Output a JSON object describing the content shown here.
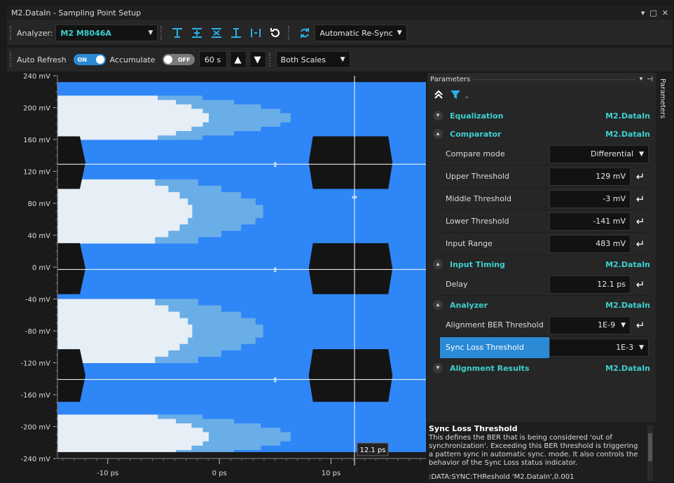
{
  "window": {
    "title": "M2.DataIn - Sampling Point Setup",
    "controls": [
      "▾",
      "□",
      "✕"
    ]
  },
  "toolbar1": {
    "analyzer_label": "Analyzer:",
    "analyzer_value": "M2 M8046A",
    "sync_mode": "Automatic Re-Sync"
  },
  "toolbar2": {
    "auto_refresh_label": "Auto Refresh",
    "auto_refresh_state": "ON",
    "accumulate_label": "Accumulate",
    "accumulate_state": "OFF",
    "interval": "60 s",
    "scales": "Both Scales"
  },
  "chart_data": {
    "type": "heatmap",
    "y_ticks": [
      "240 mV",
      "200 mV",
      "160 mV",
      "120 mV",
      "80 mV",
      "40 mV",
      "0 mV",
      "-40 mV",
      "-80 mV",
      "-120 mV",
      "-160 mV",
      "-200 mV",
      "-240 mV"
    ],
    "x_ticks": [
      "-10 ps",
      "0 ps",
      "10 ps"
    ],
    "ylim": [
      -240,
      240
    ],
    "xlim": [
      -14.5,
      18.5
    ],
    "thresholds_mV": [
      129,
      -3,
      -141
    ],
    "delay_ps": 12.1,
    "cursor_label": "12.1 ps",
    "colors": {
      "strong": "#2f86f6",
      "medium": "#6aaee8",
      "light": "#e6eef6",
      "void": "#141414"
    }
  },
  "params": {
    "header": "Parameters",
    "side_tab": "Parameters",
    "sections": {
      "equalization": {
        "name": "Equalization",
        "target": "M2.DataIn"
      },
      "comparator": {
        "name": "Comparator",
        "target": "M2.DataIn"
      },
      "input_timing": {
        "name": "Input Timing",
        "target": "M2.DataIn"
      },
      "analyzer": {
        "name": "Analyzer",
        "target": "M2.DataIn"
      },
      "alignment_results": {
        "name": "Alignment Results",
        "target": "M2.DataIn"
      }
    },
    "compare_mode": {
      "label": "Compare mode",
      "value": "Differential"
    },
    "upper_threshold": {
      "label": "Upper Threshold",
      "value": "129 mV"
    },
    "middle_threshold": {
      "label": "Middle Threshold",
      "value": "-3 mV"
    },
    "lower_threshold": {
      "label": "Lower Threshold",
      "value": "-141 mV"
    },
    "input_range": {
      "label": "Input Range",
      "value": "483 mV"
    },
    "delay": {
      "label": "Delay",
      "value": "12.1 ps"
    },
    "alignment_ber": {
      "label": "Alignment BER Threshold",
      "value": "1E-9"
    },
    "sync_loss": {
      "label": "Sync Loss Threshold",
      "value": "1E-3"
    }
  },
  "description": {
    "title": "Sync Loss Threshold",
    "text": "This defines the BER that is being considered 'out of synchronization'. Exceeding this BER threshold is triggering a pattern sync in automatic sync. mode. It also controls the behavior of the Sync Loss status indicator.",
    "command": ":DATA:SYNC:THReshold 'M2.DataIn',0.001"
  }
}
